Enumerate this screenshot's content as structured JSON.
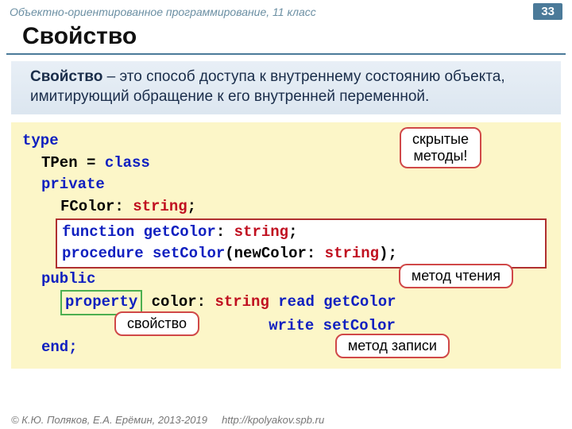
{
  "header": {
    "breadcrumb": "Объектно-ориентированное программирование, 11 класс",
    "page": "33"
  },
  "title": "Свойство",
  "definition": {
    "term": "Свойство",
    "rest": " – это способ доступа к внутреннему состоянию объекта, имитирующий обращение к его внутренней переменной."
  },
  "code": {
    "l1": "type",
    "l2a": "TPen = ",
    "l2b": "class",
    "l3": "private",
    "l4a": "FColor: ",
    "l4b": "string",
    "l4c": ";",
    "l5a": "function",
    "l5b": " getColor",
    "l5c": ": ",
    "l5d": "string",
    "l5e": ";",
    "l6a": "procedure",
    "l6b": " setColor",
    "l6c": "(newColor: ",
    "l6d": "string",
    "l6e": ");",
    "l7": "public",
    "l8a": "property",
    "l8b": " color: ",
    "l8c": "string",
    "l8d": " read",
    "l8e": " getColor",
    "l9a": "write",
    "l9b": " setColor",
    "l10": "end;"
  },
  "callouts": {
    "hidden": "скрытые\nметоды!",
    "read": "метод чтения",
    "prop": "свойство",
    "write": "метод записи"
  },
  "footer": {
    "copyright": "© К.Ю. Поляков, Е.А. Ерёмин, 2013-2019",
    "url": "http://kpolyakov.spb.ru"
  }
}
